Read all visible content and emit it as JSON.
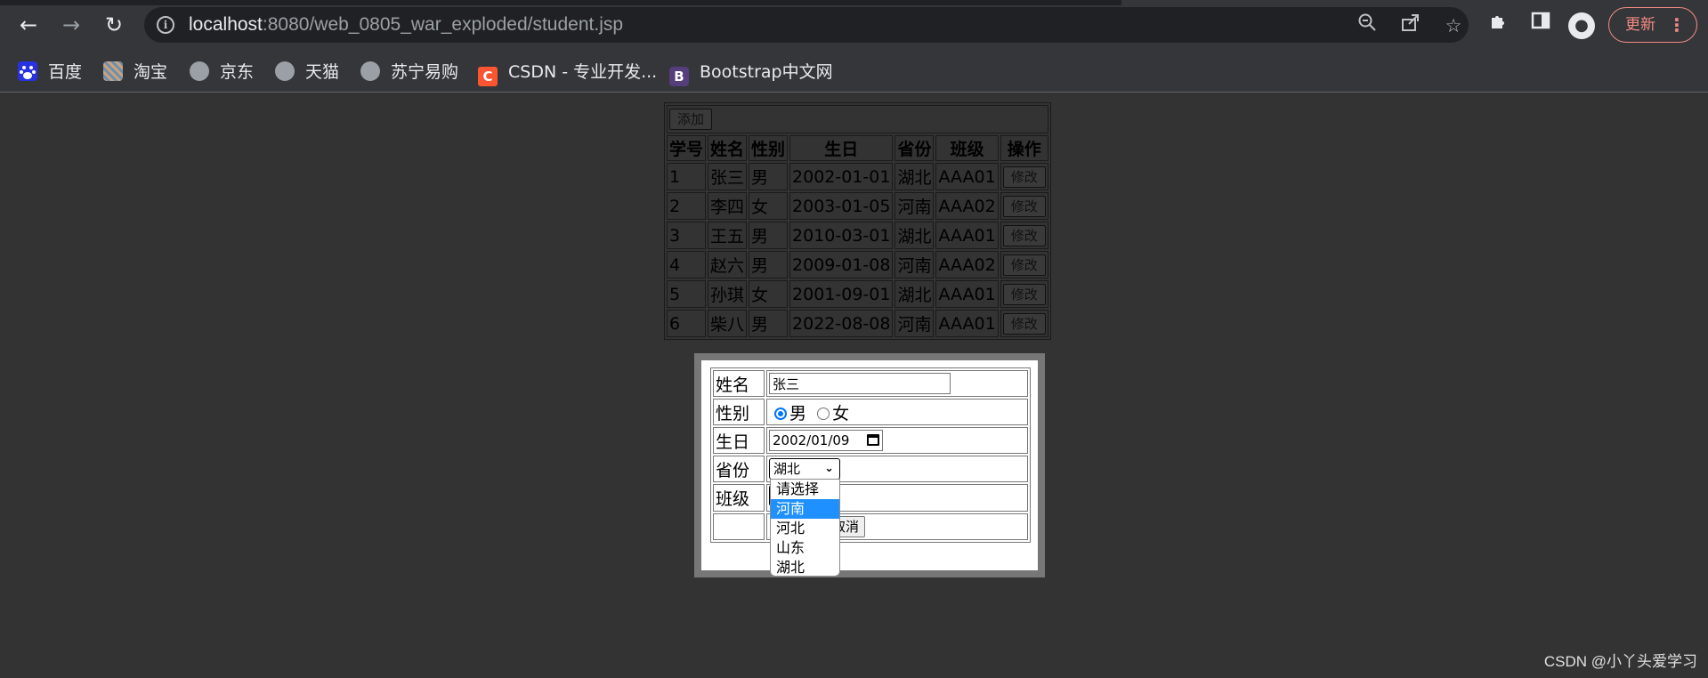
{
  "browser": {
    "url_host": "localhost",
    "url_rest": ":8080/web_0805_war_exploded/student.jsp",
    "update_label": "更新",
    "icons": {
      "back": "back-arrow-icon",
      "forward": "forward-arrow-icon",
      "reload": "reload-icon",
      "info": "info-icon",
      "zoom": "zoom-icon",
      "share": "share-icon",
      "star": "star-icon",
      "extensions": "puzzle-icon",
      "sidepanel": "side-panel-icon",
      "profile": "profile-icon",
      "menu": "kebab-menu-icon"
    }
  },
  "bookmarks": [
    {
      "label": "百度",
      "icon": "baidu-icon",
      "color": "#2932e1"
    },
    {
      "label": "淘宝",
      "icon": "taobao-icon",
      "color": "#8a6d5a"
    },
    {
      "label": "京东",
      "icon": "globe-icon",
      "color": "#9aa0a6"
    },
    {
      "label": "天猫",
      "icon": "globe-icon",
      "color": "#9aa0a6"
    },
    {
      "label": "苏宁易购",
      "icon": "globe-icon",
      "color": "#9aa0a6"
    },
    {
      "label": "CSDN - 专业开发...",
      "icon": "csdn-icon",
      "color": "#fc5531"
    },
    {
      "label": "Bootstrap中文网",
      "icon": "bootstrap-icon",
      "color": "#563d7c"
    }
  ],
  "student_table": {
    "add_label": "添加",
    "headers": [
      "学号",
      "姓名",
      "性别",
      "生日",
      "省份",
      "班级",
      "操作"
    ],
    "edit_label": "修改",
    "rows": [
      [
        "1",
        "张三",
        "男",
        "2002-01-01",
        "湖北",
        "AAA01"
      ],
      [
        "2",
        "李四",
        "女",
        "2003-01-05",
        "河南",
        "AAA02"
      ],
      [
        "3",
        "王五",
        "男",
        "2010-03-01",
        "湖北",
        "AAA01"
      ],
      [
        "4",
        "赵六",
        "男",
        "2009-01-08",
        "河南",
        "AAA02"
      ],
      [
        "5",
        "孙琪",
        "女",
        "2001-09-01",
        "湖北",
        "AAA01"
      ],
      [
        "6",
        "柴八",
        "男",
        "2022-08-08",
        "河南",
        "AAA01"
      ]
    ]
  },
  "edit_form": {
    "name_label": "姓名",
    "name_value": "张三",
    "gender_label": "性别",
    "gender_male": "男",
    "gender_female": "女",
    "birthday_label": "生日",
    "birthday_value": "2002/01/09",
    "province_label": "省份",
    "province_value": "湖北",
    "class_label": "班级",
    "cancel_label": "取消",
    "province_options": [
      "请选择",
      "河南",
      "河北",
      "山东",
      "湖北"
    ],
    "highlighted_option": "河南"
  },
  "watermark": "CSDN @小丫头爱学习"
}
